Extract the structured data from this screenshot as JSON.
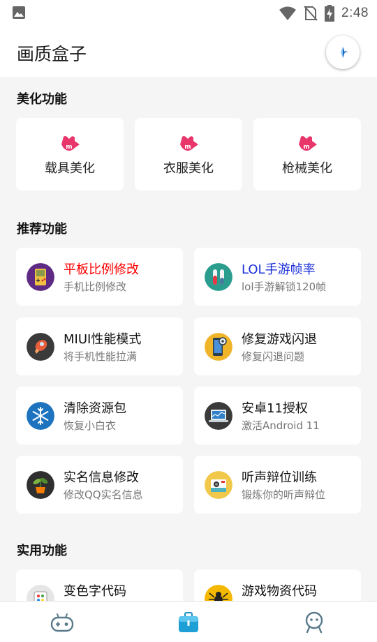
{
  "status_bar": {
    "time": "2:48",
    "icons": [
      "image-icon",
      "wifi-icon",
      "no-sim-icon",
      "battery-charging-icon"
    ]
  },
  "app_bar": {
    "title": "画质盒子",
    "action_icon": "compass-icon"
  },
  "sections": {
    "beautify": {
      "title": "美化功能",
      "items": [
        {
          "label": "载具美化",
          "icon": "badge-m-icon"
        },
        {
          "label": "衣服美化",
          "icon": "badge-m-icon"
        },
        {
          "label": "枪械美化",
          "icon": "badge-m-icon"
        }
      ]
    },
    "recommended": {
      "title": "推荐功能",
      "items": [
        {
          "title": "平板比例修改",
          "subtitle": "手机比例修改",
          "icon": "gameboy-icon",
          "title_color": "#ff0000"
        },
        {
          "title": "LOL手游帧率",
          "subtitle": "lol手游解锁120帧",
          "icon": "test-tubes-icon",
          "title_color": "#1a2fdc"
        },
        {
          "title": "MIUI性能模式",
          "subtitle": "将手机性能拉满",
          "icon": "rocket-icon",
          "title_color": "#111111"
        },
        {
          "title": "修复游戏闪退",
          "subtitle": "修复闪退问题",
          "icon": "phone-settings-icon",
          "title_color": "#111111"
        },
        {
          "title": "清除资源包",
          "subtitle": "恢复小白衣",
          "icon": "snowflake-icon",
          "title_color": "#111111"
        },
        {
          "title": "安卓11授权",
          "subtitle": "激活Android 11",
          "icon": "laptop-icon",
          "title_color": "#111111"
        },
        {
          "title": "实名信息修改",
          "subtitle": "修改QQ实名信息",
          "icon": "plant-icon",
          "title_color": "#111111"
        },
        {
          "title": "听声辩位训练",
          "subtitle": "锻炼你的听声辩位",
          "icon": "camera-icon",
          "title_color": "#111111"
        }
      ]
    },
    "utility": {
      "title": "实用功能",
      "items": [
        {
          "title": "变色字代码",
          "icon": "color-palette-icon",
          "title_color": "#111111"
        },
        {
          "title": "游戏物资代码",
          "icon": "spider-icon",
          "title_color": "#111111"
        }
      ]
    }
  },
  "bottom_nav": {
    "items": [
      {
        "name": "games",
        "icon": "gamepad-robot-icon",
        "active": false
      },
      {
        "name": "toolbox",
        "icon": "toolbox-icon",
        "active": true
      },
      {
        "name": "profile",
        "icon": "robot-face-icon",
        "active": false
      }
    ],
    "active_color": "#1ea0d6",
    "inactive_color": "#5a7a8c"
  }
}
